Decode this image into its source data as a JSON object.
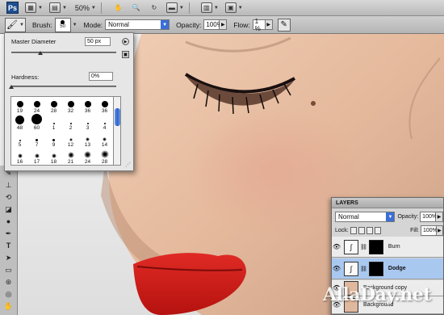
{
  "app_bar": {
    "logo": "Ps",
    "zoom": "50%"
  },
  "options_bar": {
    "brush_label": "Brush:",
    "brush_size": "50",
    "mode_label": "Mode:",
    "mode_value": "Normal",
    "opacity_label": "Opacity:",
    "opacity_value": "100%",
    "flow_label": "Flow:",
    "flow_value": "1 %"
  },
  "brush_panel": {
    "master_diameter_label": "Master Diameter",
    "master_diameter_value": "50 px",
    "master_diameter_fraction": 0.28,
    "hardness_label": "Hardness:",
    "hardness_value": "0%",
    "hardness_fraction": 0.0,
    "presets": [
      {
        "size": "19",
        "kind": "hard"
      },
      {
        "size": "24",
        "kind": "hard"
      },
      {
        "size": "28",
        "kind": "hard"
      },
      {
        "size": "32",
        "kind": "hard"
      },
      {
        "size": "36",
        "kind": "hard"
      },
      {
        "size": "36",
        "kind": "hard"
      },
      {
        "size": "48",
        "kind": "hard"
      },
      {
        "size": "60",
        "kind": "hard"
      },
      {
        "size": "1",
        "kind": "soft"
      },
      {
        "size": "2",
        "kind": "soft"
      },
      {
        "size": "3",
        "kind": "soft"
      },
      {
        "size": "4",
        "kind": "soft"
      },
      {
        "size": "5",
        "kind": "soft"
      },
      {
        "size": "7",
        "kind": "soft"
      },
      {
        "size": "9",
        "kind": "soft"
      },
      {
        "size": "12",
        "kind": "soft"
      },
      {
        "size": "13",
        "kind": "soft"
      },
      {
        "size": "14",
        "kind": "soft"
      },
      {
        "size": "16",
        "kind": "soft"
      },
      {
        "size": "17",
        "kind": "soft"
      },
      {
        "size": "18",
        "kind": "soft"
      },
      {
        "size": "21",
        "kind": "soft"
      },
      {
        "size": "24",
        "kind": "soft"
      },
      {
        "size": "28",
        "kind": "soft"
      }
    ]
  },
  "layers_panel": {
    "tab": "LAYERS",
    "blend_mode": "Normal",
    "opacity_label": "Opacity:",
    "opacity_value": "100%",
    "lock_label": "Lock:",
    "fill_label": "Fill:",
    "fill_value": "100%",
    "layers": [
      {
        "name": "Burn",
        "type": "adjustment",
        "selected": false
      },
      {
        "name": "Dodge",
        "type": "adjustment",
        "selected": true
      },
      {
        "name": "Background copy",
        "type": "image",
        "selected": false
      },
      {
        "name": "Background",
        "type": "image",
        "selected": false
      }
    ]
  },
  "watermark": "AllaDay.net",
  "colors": {
    "selection": "#a9c8f0",
    "accent": "#3b6fd6",
    "skin": "#e9c2a6",
    "lips": "#d81e1e"
  }
}
